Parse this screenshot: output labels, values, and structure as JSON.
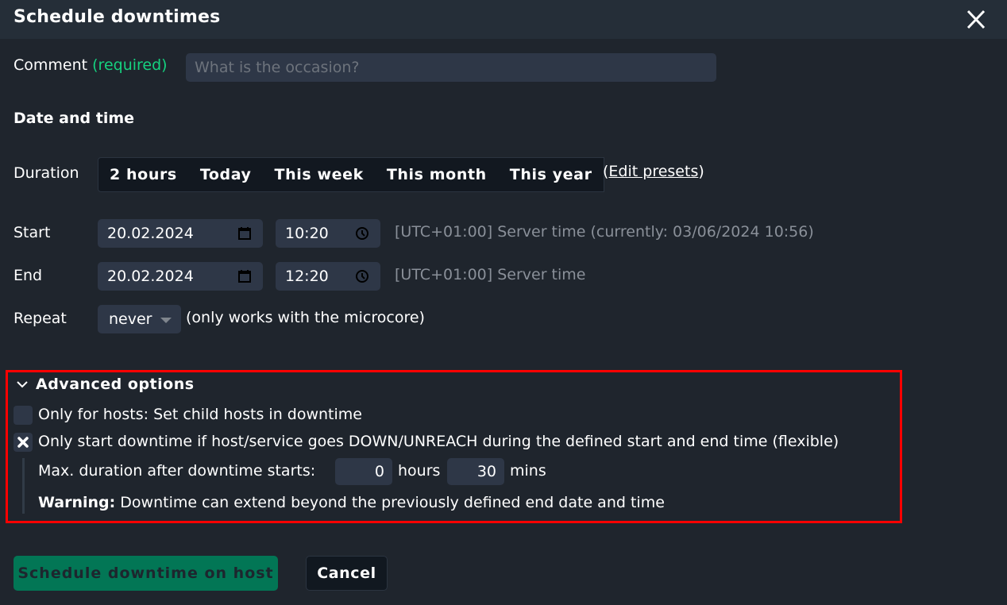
{
  "dialog": {
    "title": "Schedule downtimes",
    "close_icon": "close-icon"
  },
  "comment": {
    "label": "Comment",
    "required_label": "(required)",
    "placeholder": "What is the occasion?",
    "value": ""
  },
  "date_time": {
    "section_title": "Date and time",
    "duration_label": "Duration",
    "presets": [
      "2 hours",
      "Today",
      "This week",
      "This month",
      "This year"
    ],
    "edit_presets": {
      "open": "(",
      "label": "Edit presets",
      "close": ")"
    },
    "start": {
      "label": "Start",
      "date": "20.02.2024",
      "time": "10:20",
      "hint": "[UTC+01:00] Server time (currently: 03/06/2024 10:56)"
    },
    "end": {
      "label": "End",
      "date": "20.02.2024",
      "time": "12:20",
      "hint": "[UTC+01:00] Server time"
    },
    "repeat": {
      "label": "Repeat",
      "selected": "never",
      "hint": "(only works with the microcore)"
    }
  },
  "advanced": {
    "toggle_label": "Advanced options",
    "expanded": true,
    "child_hosts": {
      "label": "Only for hosts: Set child hosts in downtime",
      "checked": false
    },
    "flexible": {
      "label": "Only start downtime if host/service goes DOWN/UNREACH during the defined start and end time (flexible)",
      "checked": true
    },
    "max_duration": {
      "label": "Max. duration after downtime starts:",
      "hours_value": "0",
      "hours_unit": "hours",
      "mins_value": "30",
      "mins_unit": "mins"
    },
    "warning": {
      "prefix": "Warning:",
      "text": " Downtime can extend beyond the previously defined end date and time"
    }
  },
  "actions": {
    "submit_label": "Schedule downtime on host",
    "cancel_label": "Cancel"
  },
  "colors": {
    "background": "#1f252d",
    "header": "#252e38",
    "input": "#2e3747",
    "required": "#15d17f",
    "primary_button": "#027655",
    "highlight_border": "#ff0000"
  }
}
